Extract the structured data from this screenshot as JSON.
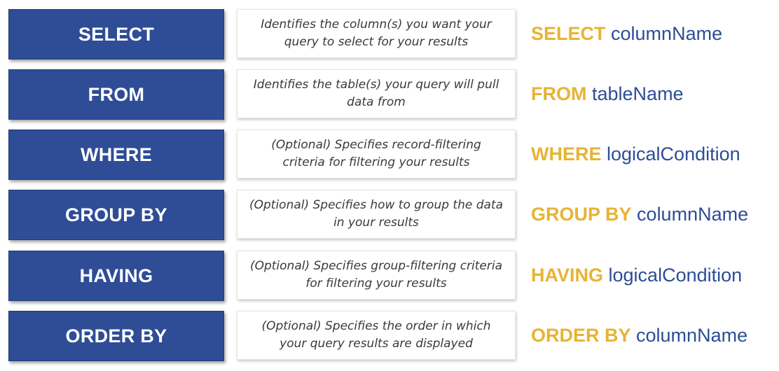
{
  "clauses": [
    {
      "keyword": "SELECT",
      "description": "Identifies the column(s) you want your query to select for your results",
      "syntax_keyword": "SELECT",
      "syntax_arg": "columnName"
    },
    {
      "keyword": "FROM",
      "description": "Identifies the table(s) your query will pull data from",
      "syntax_keyword": "FROM",
      "syntax_arg": "tableName"
    },
    {
      "keyword": "WHERE",
      "description": "(Optional) Specifies record-filtering criteria for filtering your results",
      "syntax_keyword": "WHERE",
      "syntax_arg": "logicalCondition"
    },
    {
      "keyword": "GROUP BY",
      "description": "(Optional) Specifies how to group the data in your results",
      "syntax_keyword": "GROUP BY",
      "syntax_arg": "columnName"
    },
    {
      "keyword": "HAVING",
      "description": "(Optional) Specifies group-filtering criteria for filtering your results",
      "syntax_keyword": "HAVING",
      "syntax_arg": "logicalCondition"
    },
    {
      "keyword": "ORDER BY",
      "description": "(Optional) Specifies the order in which your query results are displayed",
      "syntax_keyword": "ORDER BY",
      "syntax_arg": "columnName"
    }
  ],
  "colors": {
    "keyword_box": "#2e4d96",
    "syntax_keyword": "#e8b334",
    "syntax_arg": "#2e4d96"
  }
}
